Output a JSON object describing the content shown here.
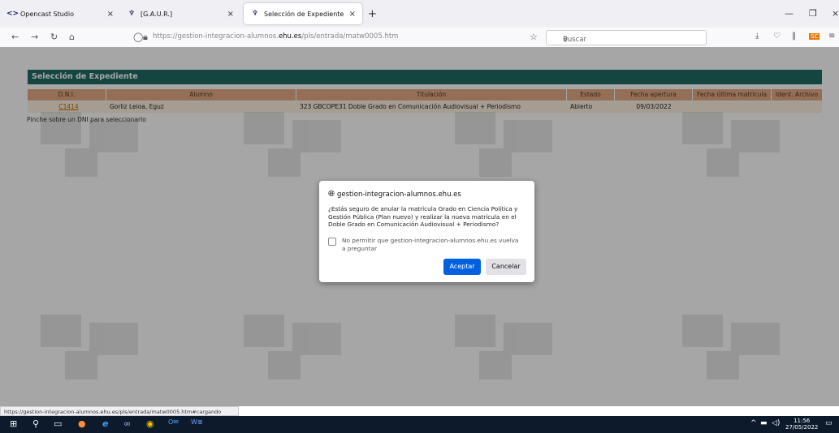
{
  "tabs": [
    {
      "label": "Opencast Studio",
      "icon": "opencast-icon"
    },
    {
      "label": "[G.A.U.R.]",
      "icon": "ehu-logo-icon"
    },
    {
      "label": "Selección de Expediente",
      "icon": "ehu-logo-icon"
    }
  ],
  "navbar": {
    "url_prefix": "https://gestion-integracion-alumnos.",
    "url_host": "ehu.es",
    "url_path": "/pls/entrada/matw0005.htm",
    "search_placeholder": "Buscar"
  },
  "page": {
    "panel_title": "Selección de Expediente",
    "columns": [
      "D.N.I.",
      "Alumno",
      "Titulación",
      "Estado",
      "Fecha apertura",
      "Fecha última matrícula",
      "Ident. Archivo"
    ],
    "rows": [
      {
        "dni": "C1414",
        "alumno": "Gorliz Leioa, Eguz",
        "titulacion": "323   GBCOPE31   Doble Grado en Comunicación Audiovisual + Periodismo",
        "estado": "Abierto",
        "fecha_apertura": "09/03/2022",
        "fecha_ultima": "",
        "ident": ""
      }
    ],
    "hint": "Pinche sobre un DNI para seleccionarlo"
  },
  "dialog": {
    "origin": "gestion-integracion-alumnos.ehu.es",
    "message": "¿Estás seguro de anular la matrícula Grado en Ciencia Política y Gestión Pública (Plan nuevo) y realizar la nueva matrícula en el Doble Grado en Comunicación Audiovisual + Periodismo?",
    "checkbox_label": "No permitir que gestion-integracion-alumnos.ehu.es vuelva a preguntar",
    "accept": "Aceptar",
    "cancel": "Cancelar"
  },
  "status_bar": "https://gestion-integracion-alumnos.ehu.es/pls/entrada/matw0005.htm#cargando",
  "clock": {
    "time": "11:56",
    "date": "27/05/2022"
  }
}
